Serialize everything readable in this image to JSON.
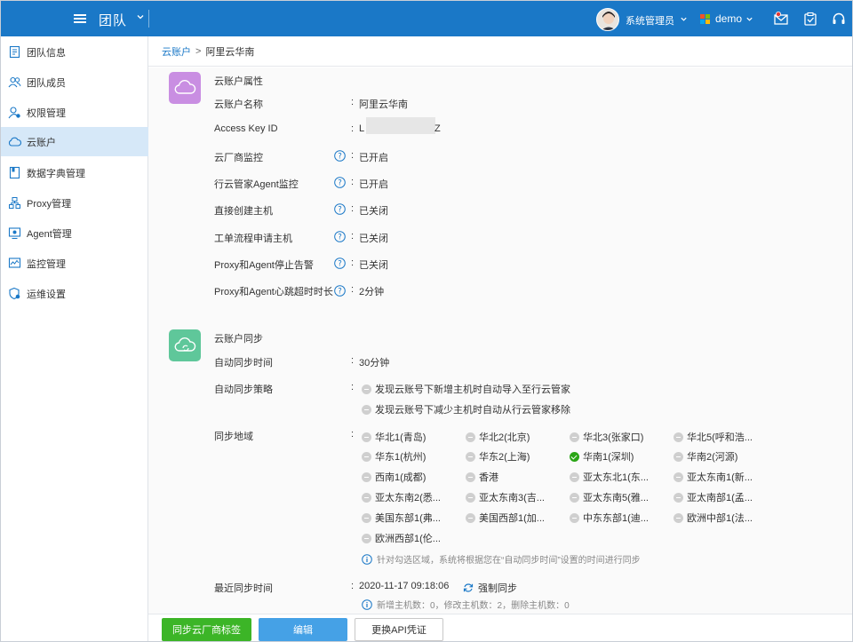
{
  "topbar": {
    "title": "团队",
    "user_name": "系统管理员",
    "tenant": "demo",
    "brand_color": "#1a78c7",
    "icons": [
      "menu-icon",
      "chevron-down-icon",
      "avatar",
      "microsoft-logo",
      "mail-icon",
      "task-icon",
      "headset-icon"
    ]
  },
  "sidebar": {
    "items": [
      {
        "label": "团队信息",
        "icon": "document-icon",
        "active": false
      },
      {
        "label": "团队成员",
        "icon": "users-icon",
        "active": false
      },
      {
        "label": "权限管理",
        "icon": "user-settings-icon",
        "active": false
      },
      {
        "label": "云账户",
        "icon": "cloud-icon",
        "active": true
      },
      {
        "label": "数据字典管理",
        "icon": "book-icon",
        "active": false
      },
      {
        "label": "Proxy管理",
        "icon": "network-icon",
        "active": false
      },
      {
        "label": "Agent管理",
        "icon": "agent-icon",
        "active": false
      },
      {
        "label": "监控管理",
        "icon": "monitor-chart-icon",
        "active": false
      },
      {
        "label": "运维设置",
        "icon": "shield-gear-icon",
        "active": false
      }
    ]
  },
  "breadcrumb": {
    "parent": "云账户",
    "separator": ">",
    "current": "阿里云华南"
  },
  "properties": {
    "title": "云账户属性",
    "rows": [
      {
        "label": "云账户名称",
        "value": "阿里云华南"
      },
      {
        "label": "Access Key ID",
        "value_start": "L",
        "value_end": "Z"
      },
      {
        "label": "云厂商监控",
        "value": "已开启"
      },
      {
        "label": "行云管家Agent监控",
        "value": "已开启"
      },
      {
        "label": "直接创建主机",
        "value": "已关闭"
      },
      {
        "label": "工单流程申请主机",
        "value": "已关闭"
      },
      {
        "label": "Proxy和Agent停止告警",
        "value": "已关闭"
      },
      {
        "label": "Proxy和Agent心跳超时时长",
        "value": "2分钟"
      }
    ]
  },
  "sync": {
    "title": "云账户同步",
    "auto_time_label": "自动同步时间",
    "auto_time_value": "30分钟",
    "strategy_label": "自动同步策略",
    "strategies": [
      "发现云账号下新增主机时自动导入至行云管家",
      "发现云账号下减少主机时自动从行云管家移除"
    ],
    "region_label": "同步地域",
    "regions": [
      {
        "name": "华北1(青岛)",
        "checked": false
      },
      {
        "name": "华北2(北京)",
        "checked": false
      },
      {
        "name": "华北3(张家口)",
        "checked": false
      },
      {
        "name": "华北5(呼和浩...",
        "checked": false
      },
      {
        "name": "华东1(杭州)",
        "checked": false
      },
      {
        "name": "华东2(上海)",
        "checked": false
      },
      {
        "name": "华南1(深圳)",
        "checked": true
      },
      {
        "name": "华南2(河源)",
        "checked": false
      },
      {
        "name": "西南1(成都)",
        "checked": false
      },
      {
        "name": "香港",
        "checked": false
      },
      {
        "name": "亚太东北1(东...",
        "checked": false
      },
      {
        "name": "亚太东南1(新...",
        "checked": false
      },
      {
        "name": "亚太东南2(悉...",
        "checked": false
      },
      {
        "name": "亚太东南3(吉...",
        "checked": false
      },
      {
        "name": "亚太东南5(雅...",
        "checked": false
      },
      {
        "name": "亚太南部1(孟...",
        "checked": false
      },
      {
        "name": "美国东部1(弗...",
        "checked": false
      },
      {
        "name": "美国西部1(加...",
        "checked": false
      },
      {
        "name": "中东东部1(迪...",
        "checked": false
      },
      {
        "name": "欧洲中部1(法...",
        "checked": false
      },
      {
        "name": "欧洲西部1(伦...",
        "checked": false
      }
    ],
    "region_note": "针对勾选区域，系统将根据您在“自动同步时间”设置的时间进行同步",
    "last_sync_label": "最近同步时间",
    "last_sync_value": "2020-11-17 09:18:06",
    "force_sync_label": "强制同步",
    "sync_result": "新增主机数：0，修改主机数：2，删除主机数：0"
  },
  "footer": {
    "sync_tags_button": "同步云厂商标签",
    "edit_button": "编辑",
    "replace_api_button": "更换API凭证"
  },
  "colors": {
    "accent": "#1a78c7",
    "green": "#3cb527",
    "edit_blue": "#45a1e6",
    "purple_card": "#c98ee2",
    "green_card": "#5fc79a",
    "active_nav": "#d6e8f8"
  }
}
